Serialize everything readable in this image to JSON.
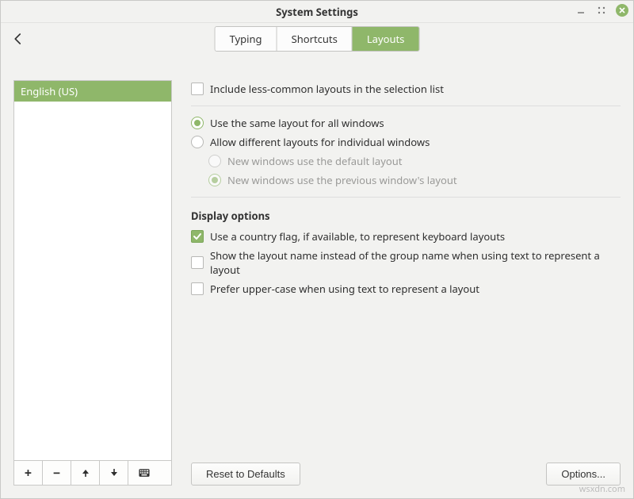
{
  "window": {
    "title": "System Settings"
  },
  "tabs": {
    "typing": "Typing",
    "shortcuts": "Shortcuts",
    "layouts": "Layouts",
    "active": "layouts"
  },
  "layouts_list": {
    "items": [
      "English (US)"
    ]
  },
  "options": {
    "include_less_common": "Include less-common layouts in the selection list",
    "same_layout_all": "Use the same layout for all windows",
    "allow_different": "Allow different layouts for individual windows",
    "new_win_default": "New windows use the default layout",
    "new_win_previous": "New windows use the previous window's layout"
  },
  "display": {
    "heading": "Display options",
    "use_flag": "Use a country flag, if available,  to represent keyboard layouts",
    "show_layout_name": "Show the layout name instead of the group name when using text to represent a layout",
    "prefer_upper": "Prefer upper-case when using text to represent a layout"
  },
  "buttons": {
    "reset": "Reset to Defaults",
    "options": "Options..."
  },
  "watermark": "wsxdn.com"
}
